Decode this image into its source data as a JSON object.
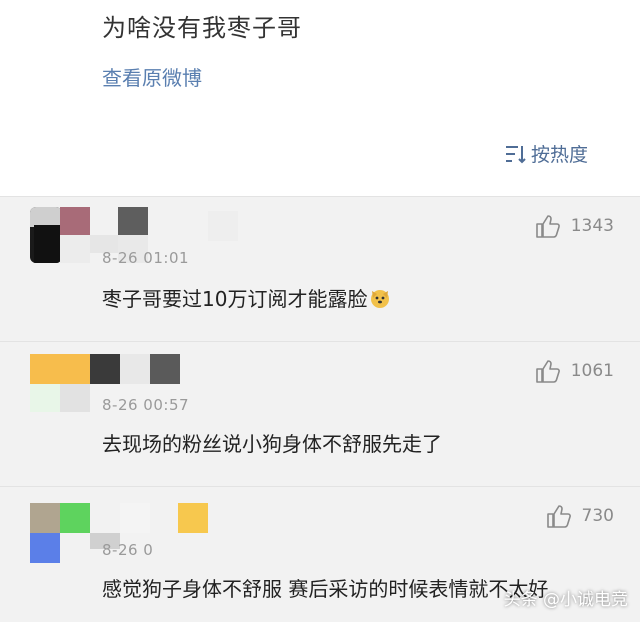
{
  "post": {
    "text": "为啥没有我枣子哥",
    "view_original": "查看原微博",
    "sort_label": "按热度",
    "sort_icon": "sort-lines-icon"
  },
  "comments": [
    {
      "time": "8-26 01:01",
      "text": "枣子哥要过10万订阅才能露脸",
      "likes": "1343",
      "emoji": "dog-face-emoji"
    },
    {
      "time": "8-26 00:57",
      "text": "去现场的粉丝说小狗身体不舒服先走了",
      "likes": "1061"
    },
    {
      "time": "8-26 0",
      "text": "感觉狗子身体不舒服 赛后采访的时候表情就不太好",
      "likes": "730"
    }
  ],
  "watermark": "头条 @小诚电竞",
  "colors": {
    "link": "#5a7fb0",
    "background": "#f2f2f2",
    "post_bg": "#ffffff"
  }
}
